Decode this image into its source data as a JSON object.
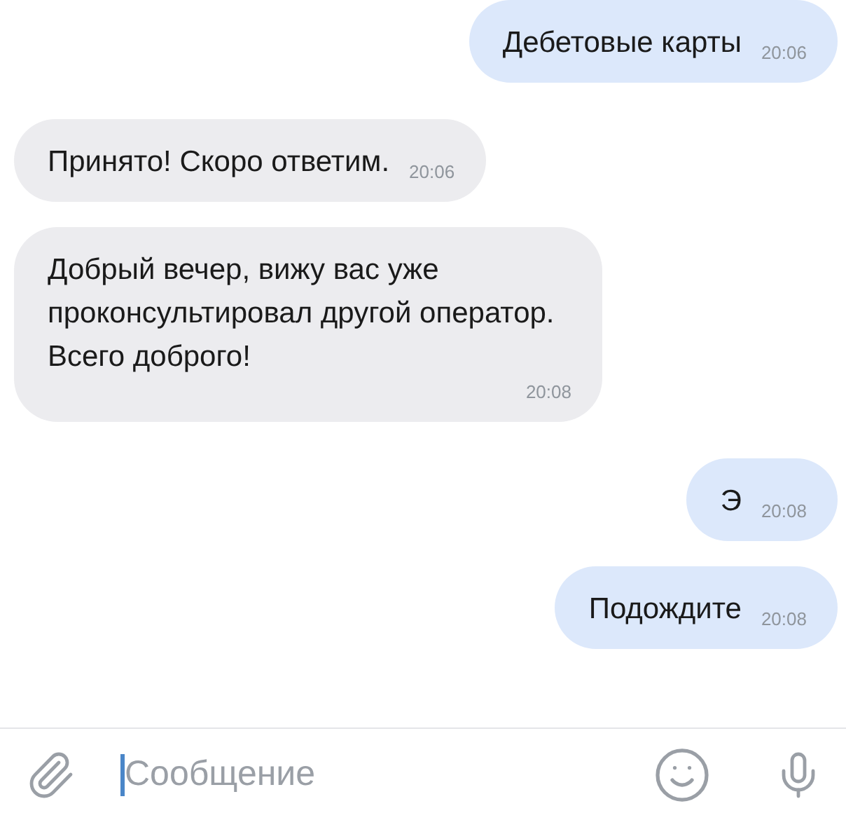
{
  "messages": [
    {
      "kind": "outgoing",
      "text": "Дебетовые карты",
      "time": "20:06"
    },
    {
      "kind": "incoming",
      "text": "Принято! Скоро ответим.",
      "time": "20:06"
    },
    {
      "kind": "incoming",
      "text": "Добрый вечер, вижу вас уже проконсультировал другой оператор. Всего доброго!",
      "time": "20:08"
    },
    {
      "kind": "outgoing",
      "text": "Э",
      "time": "20:08"
    },
    {
      "kind": "outgoing",
      "text": "Подождите",
      "time": "20:08"
    }
  ],
  "composer": {
    "placeholder": "Сообщение"
  }
}
